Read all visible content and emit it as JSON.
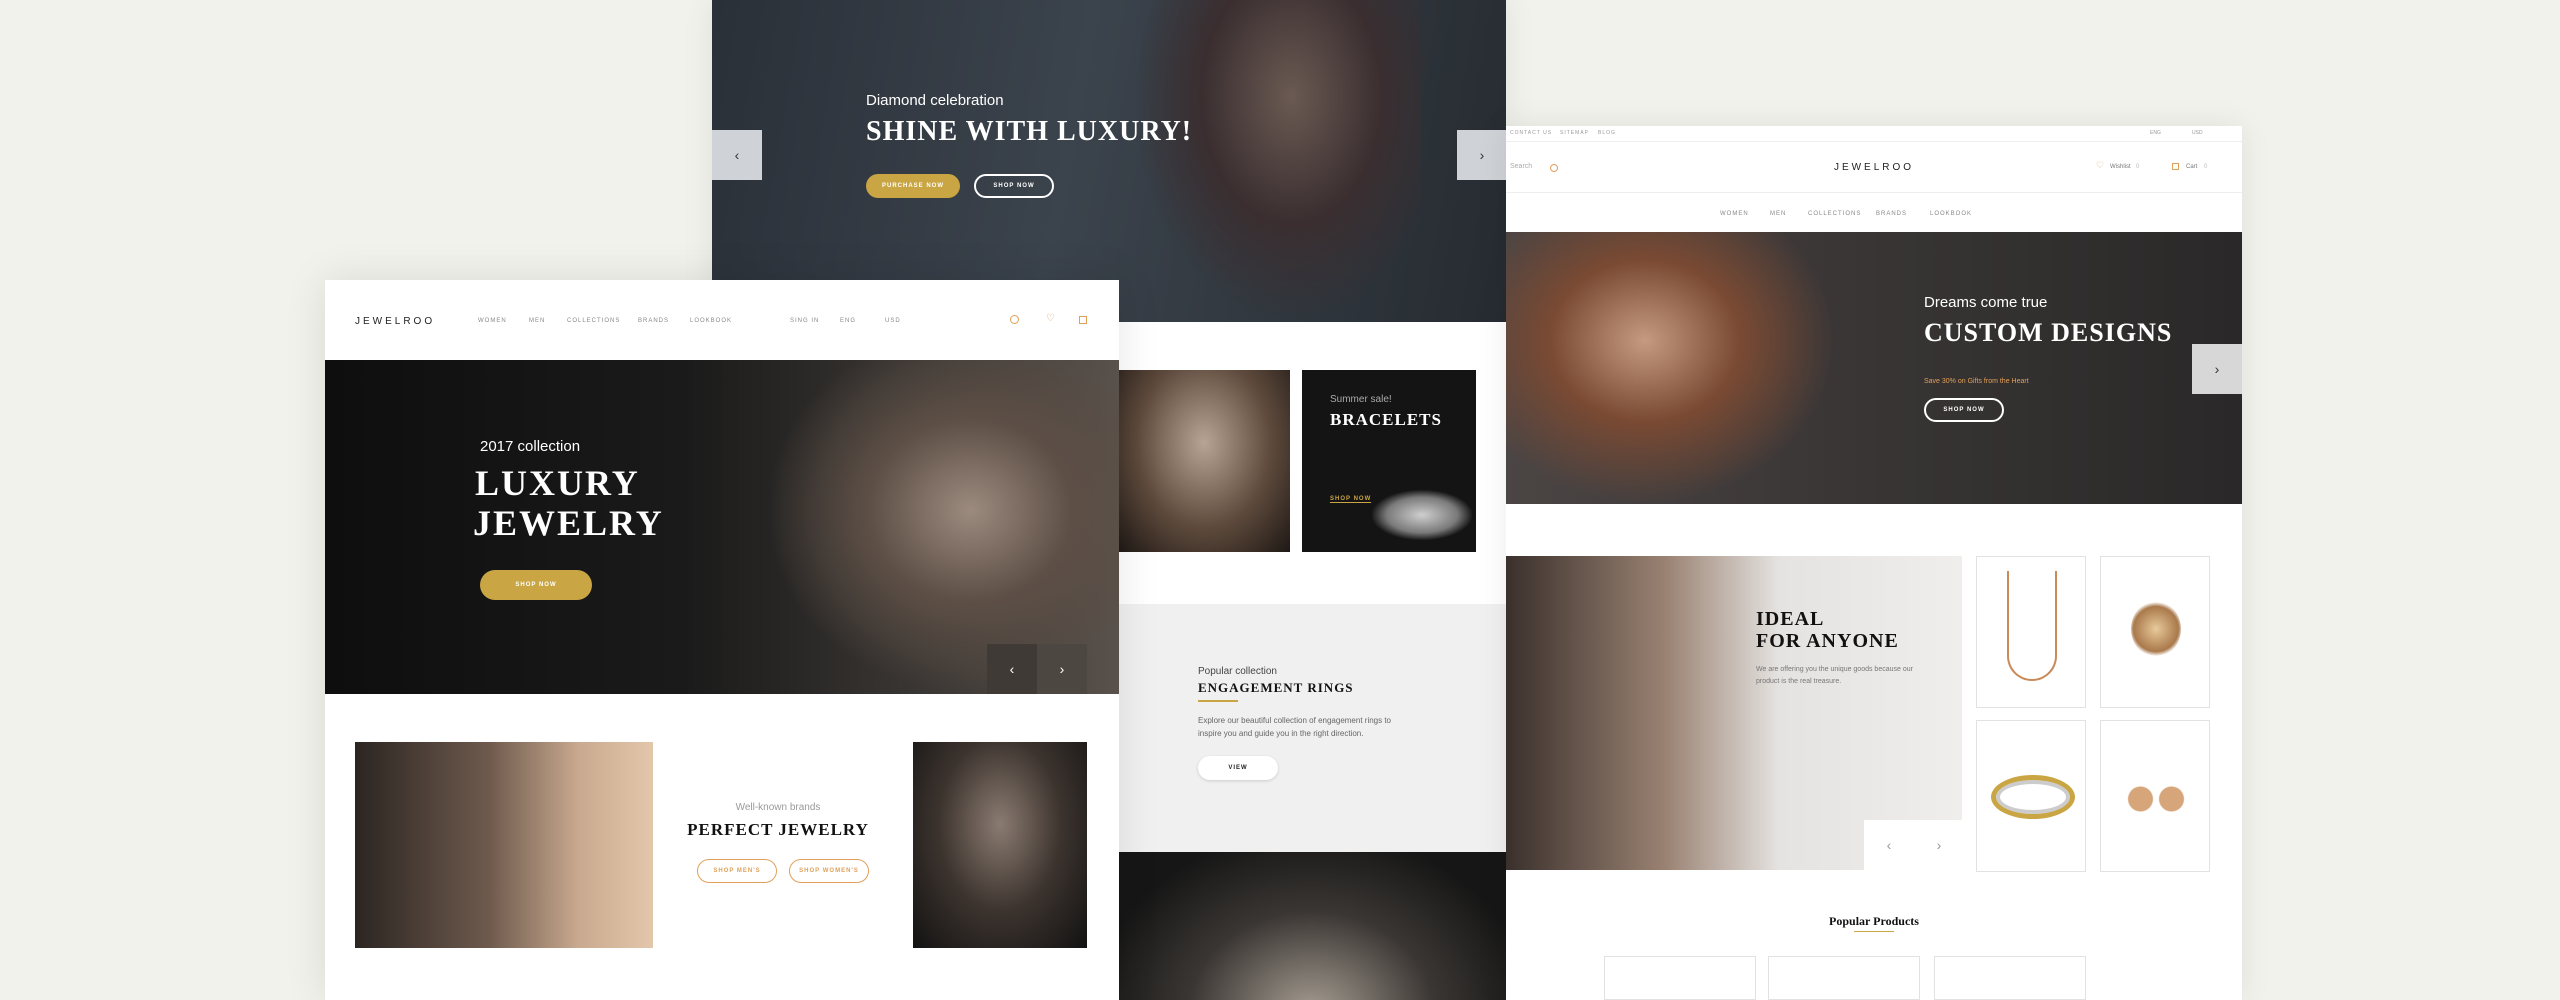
{
  "logo": "JEWELROO",
  "top_mockup": {
    "kicker": "Diamond celebration",
    "title": "SHINE WITH LUXURY!",
    "primary_btn": "PURCHASE NOW",
    "secondary_btn": "SHOP NOW",
    "prev": "‹",
    "next": "›"
  },
  "left_mockup": {
    "nav": [
      "WOMEN",
      "MEN",
      "COLLECTIONS",
      "BRANDS",
      "LOOKBOOK"
    ],
    "sign_in": "SING IN",
    "lang": "ENG",
    "currency": "USD",
    "hero_kicker": "2017 collection",
    "hero_line1": "LUXURY",
    "hero_line2": "JEWELRY",
    "hero_btn": "SHOP NOW",
    "prev": "‹",
    "next": "›",
    "brands_kicker": "Well-known brands",
    "brands_title": "PERFECT JEWELRY",
    "shop_mens": "SHOP MEN'S",
    "shop_womens": "SHOP WOMEN'S"
  },
  "middle_mockup": {
    "bracelets_kicker": "Summer sale!",
    "bracelets_title": "BRACELETS",
    "bracelets_link": "SHOP NOW",
    "popular_kicker": "Popular collection",
    "popular_title": "ENGAGEMENT RINGS",
    "popular_text": "Explore our beautiful collection of engagement rings to inspire you and guide you in the right direction.",
    "view_btn": "VIEW"
  },
  "right_mockup": {
    "topbar_links": [
      "CONTACT US",
      "SITEMAP",
      "BLOG"
    ],
    "topbar_lang": "ENG",
    "topbar_currency": "USD",
    "search_placeholder": "Search",
    "wishlist": "Wishlist",
    "wishlist_count": "0",
    "cart": "Cart",
    "cart_count": "0",
    "nav": [
      "WOMEN",
      "MEN",
      "COLLECTIONS",
      "BRANDS",
      "LOOKBOOK"
    ],
    "hero_kicker": "Dreams come true",
    "hero_title": "CUSTOM DESIGNS",
    "hero_sub": "Save 30% on Gifts from the Heart",
    "hero_btn": "SHOP NOW",
    "next": "›",
    "ideal_line1": "IDEAL",
    "ideal_line2": "FOR ANYONE",
    "ideal_text": "We are offering you the unique goods because our product is the real treasure.",
    "prev": "‹",
    "next2": "›",
    "popular_products": "Popular Products"
  },
  "colors": {
    "gold": "#c9a544",
    "orange": "#e0a05a",
    "dark": "#1b1b1b"
  }
}
